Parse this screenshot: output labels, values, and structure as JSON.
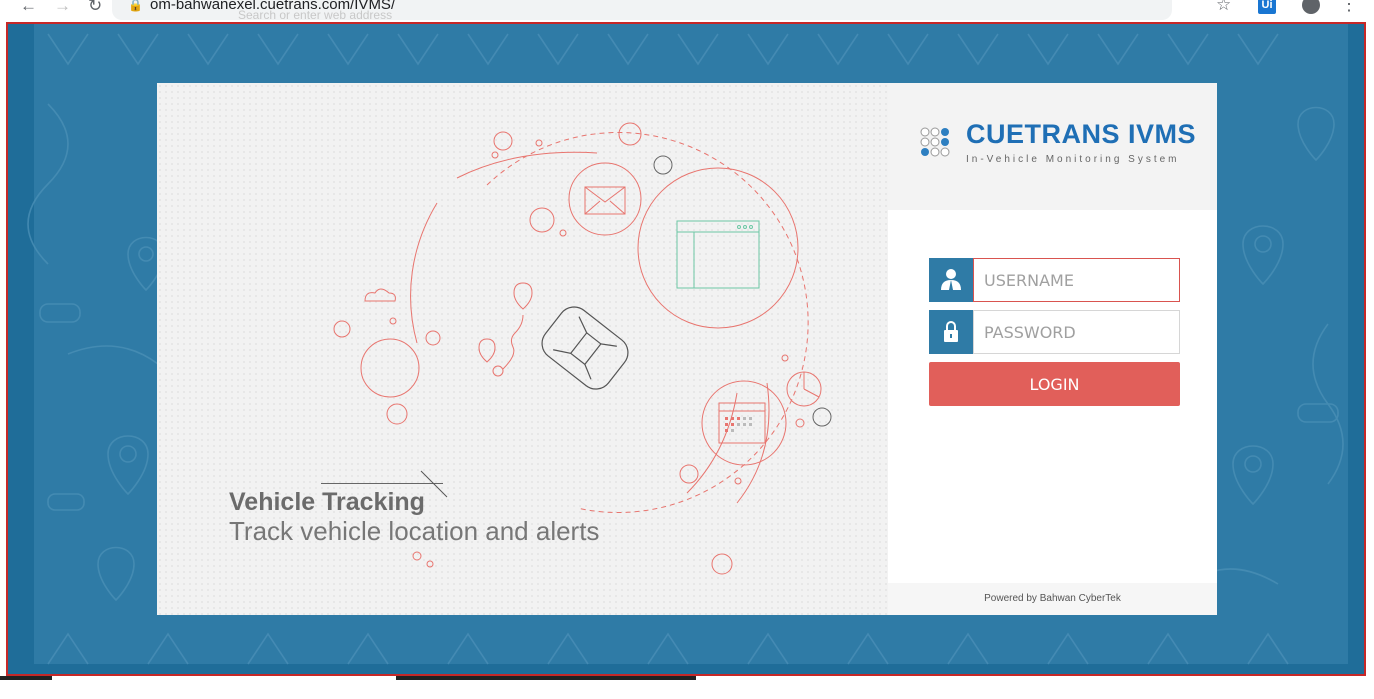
{
  "browser": {
    "url": "om-bahwanexel.cuetrans.com/IVMS/",
    "ghost_placeholder": "Search or enter web address",
    "extension_badge": "Ui"
  },
  "icons": {
    "back": "arrow-left-icon",
    "forward": "arrow-right-icon",
    "reload": "reload-icon",
    "lock": "lock-icon",
    "star": "star-icon",
    "account": "account-icon",
    "menu": "more-vert-icon",
    "user": "user-icon",
    "padlock": "padlock-icon"
  },
  "colors": {
    "page_bg": "#2f7ba6",
    "brand_blue": "#1f6fb5",
    "login_button": "#e15f5a",
    "field_icon_bg": "#2f7ba6"
  },
  "logo": {
    "brand": "CUETRANS IVMS",
    "tagline": "In-Vehicle Monitoring System"
  },
  "login": {
    "username_placeholder": "USERNAME",
    "password_placeholder": "PASSWORD",
    "button_label": "LOGIN"
  },
  "hero": {
    "title": "Vehicle Tracking",
    "subtitle": "Track vehicle location and alerts"
  },
  "footer": {
    "powered_by": "Powered by Bahwan CyberTek"
  }
}
